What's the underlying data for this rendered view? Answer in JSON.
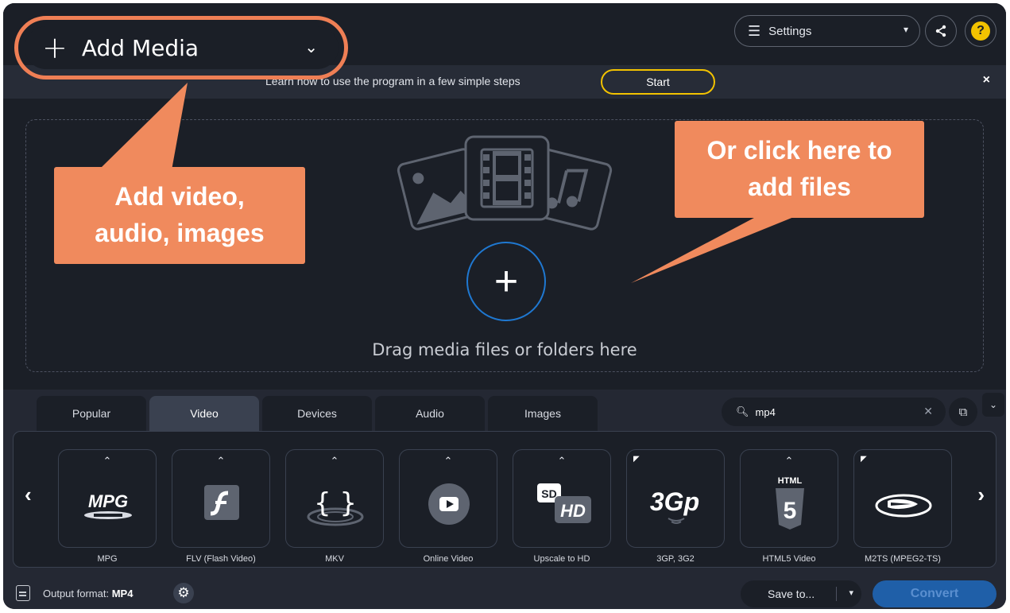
{
  "header": {
    "add_media_label": "Add Media",
    "settings_label": "Settings",
    "help_label": "?"
  },
  "tutorial": {
    "text": "Learn how to use the program in a few simple steps",
    "start_label": "Start",
    "close_label": "×"
  },
  "drop_area": {
    "text": "Drag media files or folders here"
  },
  "callouts": {
    "left": [
      "Add video,",
      "audio, images"
    ],
    "right": [
      "Or click here to",
      "add files"
    ]
  },
  "tabs": [
    {
      "label": "Popular",
      "active": false
    },
    {
      "label": "Video",
      "active": true
    },
    {
      "label": "Devices",
      "active": false
    },
    {
      "label": "Audio",
      "active": false
    },
    {
      "label": "Images",
      "active": false
    }
  ],
  "search": {
    "value": "mp4"
  },
  "formats": [
    {
      "label": "MPG",
      "icon": "mpg-icon"
    },
    {
      "label": "FLV (Flash Video)",
      "icon": "flash-icon"
    },
    {
      "label": "MKV",
      "icon": "mkv-icon"
    },
    {
      "label": "Online Video",
      "icon": "youtube-icon"
    },
    {
      "label": "Upscale to HD",
      "icon": "sd-hd-icon"
    },
    {
      "label": "3GP, 3G2",
      "icon": "3gp-icon"
    },
    {
      "label": "HTML5 Video",
      "icon": "html5-icon"
    },
    {
      "label": "M2TS (MPEG2-TS)",
      "icon": "bluray-icon"
    }
  ],
  "footer": {
    "output_label": "Output format:",
    "output_value": "MP4",
    "save_to_label": "Save to...",
    "convert_label": "Convert"
  },
  "colors": {
    "accent_orange": "#f08a5d",
    "start_border": "#f2c200",
    "convert_bg": "#1f5fa8",
    "plus_circle": "#1f78d1"
  }
}
